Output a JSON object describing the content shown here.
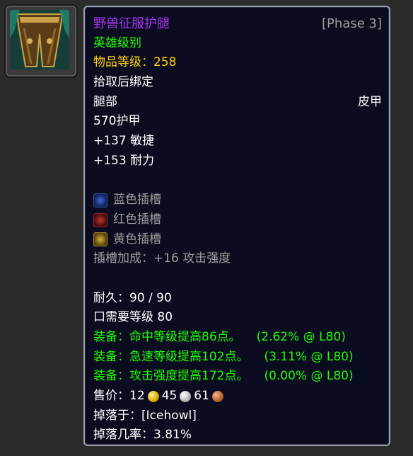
{
  "item": {
    "name": "野兽征服护腿",
    "phase": "[Phase 3]",
    "quality": "英雄级别",
    "item_level_label": "物品等级：",
    "item_level": "258",
    "bind": "拾取后绑定",
    "slot": "腿部",
    "armor_type": "皮甲",
    "armor": "570护甲",
    "stats": [
      "+137 敏捷",
      "+153 耐力"
    ],
    "sockets": [
      {
        "label": "蓝色插槽",
        "color": "blue",
        "icon": "blue-socket-icon"
      },
      {
        "label": "红色插槽",
        "color": "red",
        "icon": "red-socket-icon"
      },
      {
        "label": "黄色插槽",
        "color": "yellow",
        "icon": "yellow-socket-icon"
      }
    ],
    "socket_bonus": "插槽加成：+16 攻击强度",
    "durability": "耐久：90 / 90",
    "required_level": "口需要等级 80",
    "equip_effects": [
      {
        "text": "装备：命中等级提高86点。",
        "rating": "(2.62% @ L80)"
      },
      {
        "text": "装备：急速等级提高102点。",
        "rating": "(3.11% @ L80)"
      },
      {
        "text": "装备：攻击强度提高172点。",
        "rating": "(0.00% @ L80)"
      }
    ],
    "sell_price": {
      "label": "售价：",
      "gold": "12",
      "silver": "45",
      "copper": "61"
    },
    "drop_source": "掉落于：[Icehowl]",
    "drop_rate": "掉落几率：3.81%"
  },
  "colors": {
    "epic": "#a335ee",
    "uncommon": "#1eff00",
    "gold_text": "#ffd100",
    "gray": "#9d9d9d",
    "background": "#0b0c20"
  }
}
